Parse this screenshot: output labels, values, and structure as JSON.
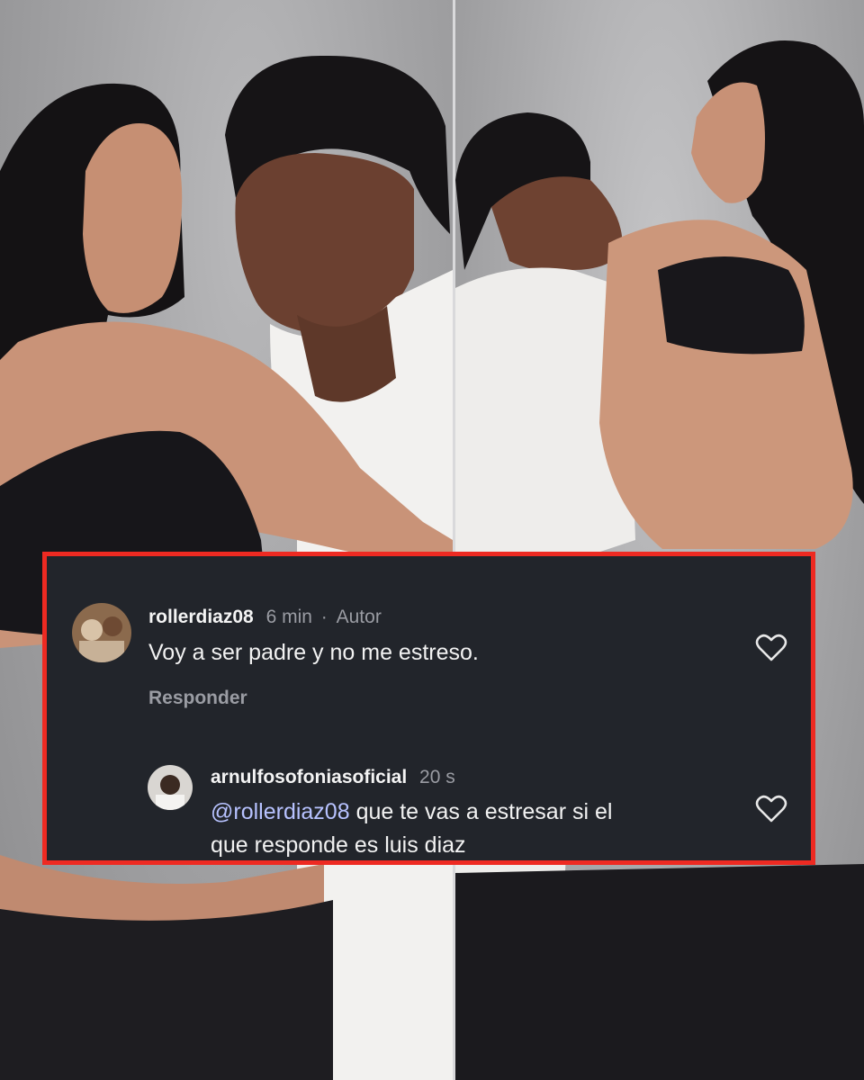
{
  "comments": [
    {
      "username": "rollerdiaz08",
      "time": "6 min",
      "separator": "·",
      "badge": "Autor",
      "text": "Voy a ser padre y no me estreso.",
      "reply_label": "Responder",
      "like_icon": "heart-outline-icon"
    },
    {
      "username": "arnulfosofoniasoficial",
      "time": "20 s",
      "mention": "@rollerdiaz08",
      "text_line1": " que te vas a estresar si el",
      "text_line2": "que responde es luis diaz",
      "like_icon": "heart-outline-icon"
    }
  ],
  "colors": {
    "card_background": "#22252b",
    "card_border": "#ee2a22",
    "mention": "#b7c2ff",
    "muted_text": "#9a9ca3"
  }
}
